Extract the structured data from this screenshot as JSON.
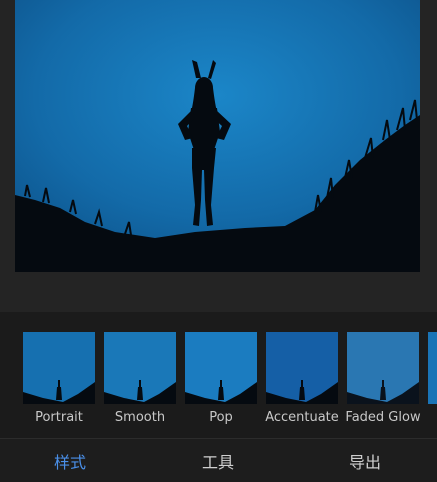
{
  "filters": [
    {
      "label": "Portrait"
    },
    {
      "label": "Smooth"
    },
    {
      "label": "Pop"
    },
    {
      "label": "Accentuate"
    },
    {
      "label": "Faded Glow"
    }
  ],
  "tabs": [
    {
      "label": "样式",
      "active": true
    },
    {
      "label": "工具",
      "active": false
    },
    {
      "label": "导出",
      "active": false
    }
  ],
  "colors": {
    "accent": "#4a8fe8",
    "sky": "#1672b3",
    "background": "#222222"
  }
}
